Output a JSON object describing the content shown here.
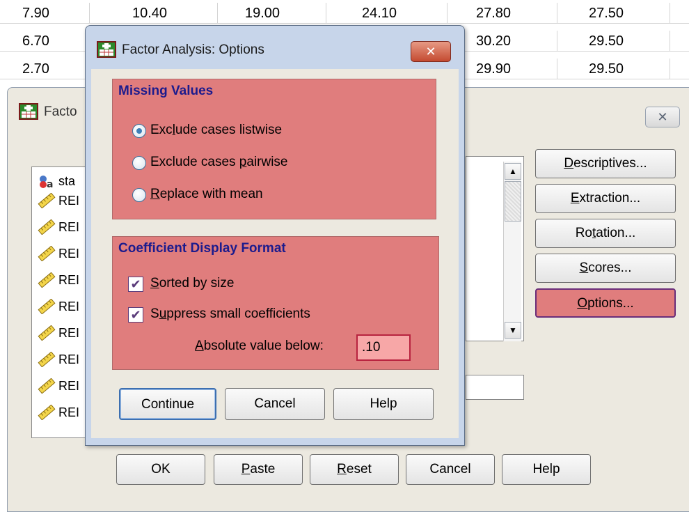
{
  "sheet": {
    "rows": [
      [
        "7.90",
        "10.40",
        "19.00",
        "24.10",
        "27.80",
        "27.50"
      ],
      [
        "6.70",
        "",
        "",
        "",
        "30.20",
        "29.50"
      ],
      [
        "2.70",
        "",
        "",
        "",
        "29.90",
        "29.50"
      ]
    ]
  },
  "main_dialog": {
    "title": "Facto",
    "close_label": "✕",
    "var_list": {
      "items": [
        "sta",
        "REI",
        "REI",
        "REI",
        "REI",
        "REI",
        "REI",
        "REI",
        "REI",
        "REI"
      ]
    },
    "side_buttons": {
      "descriptives": {
        "mn": "D",
        "rest": "escriptives..."
      },
      "extraction": {
        "mn": "E",
        "rest": "xtraction..."
      },
      "rotation": {
        "pre": "Ro",
        "mn": "t",
        "rest": "ation..."
      },
      "scores": {
        "mn": "S",
        "rest": "cores..."
      },
      "options": {
        "mn": "O",
        "rest": "ptions..."
      }
    },
    "bottom_buttons": {
      "ok": "OK",
      "paste": {
        "mn": "P",
        "rest": "aste"
      },
      "reset": {
        "mn": "R",
        "rest": "eset"
      },
      "cancel": "Cancel",
      "help": "Help"
    }
  },
  "options_dialog": {
    "title": "Factor Analysis: Options",
    "close_label": "✕",
    "missing_values": {
      "title": "Missing Values",
      "options": [
        {
          "pre": "Exc",
          "mn": "l",
          "rest": "ude cases listwise",
          "checked": true
        },
        {
          "pre": "Exclude cases ",
          "mn": "p",
          "rest": "airwise",
          "checked": false
        },
        {
          "pre": "",
          "mn": "R",
          "rest": "eplace with mean",
          "checked": false
        }
      ]
    },
    "coefficient_display": {
      "title": "Coefficient Display Format",
      "sorted": {
        "pre": "",
        "mn": "S",
        "rest": "orted by size",
        "checked": true
      },
      "suppress": {
        "pre": "S",
        "mn": "u",
        "rest": "ppress small coefficients",
        "checked": true
      },
      "absolute_label": {
        "pre": "",
        "mn": "A",
        "rest": "bsolute value below:"
      },
      "absolute_value": ".10"
    },
    "buttons": {
      "continue": "Continue",
      "cancel": "Cancel",
      "help": "Help"
    }
  },
  "colors": {
    "highlight": "#e07d7d",
    "group_title": "#1c1b8d",
    "dialog_bg": "#ece9e0",
    "title_bg": "#c7d5ea"
  }
}
